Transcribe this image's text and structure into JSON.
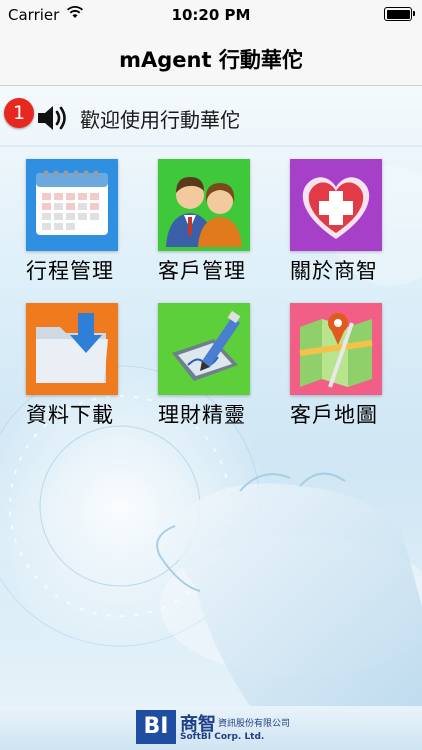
{
  "status_bar": {
    "carrier": "Carrier",
    "time": "10:20 PM"
  },
  "nav": {
    "title": "mAgent 行動華佗"
  },
  "announcement": {
    "badge_count": "1",
    "text": "歡迎使用行動華佗"
  },
  "menu": [
    {
      "label": "行程管理",
      "icon": "calendar-icon"
    },
    {
      "label": "客戶管理",
      "icon": "customers-icon"
    },
    {
      "label": "關於商智",
      "icon": "heart-cross-icon"
    },
    {
      "label": "資料下載",
      "icon": "download-folder-icon"
    },
    {
      "label": "理財精靈",
      "icon": "tablet-pen-icon"
    },
    {
      "label": "客戶地圖",
      "icon": "map-pin-icon"
    }
  ],
  "footer": {
    "logo_mark": "BI",
    "company_cn": "商智",
    "company_cn_full": "資訊股份有限公司",
    "company_en": "SoftBI Corp. Ltd."
  },
  "colors": {
    "badge": "#e8281f",
    "calendar_tile": "#2f8fe0",
    "customers_tile": "#3ec83a",
    "about_tile": "#a640c8",
    "download_tile": "#f07b1e",
    "finance_tile": "#5ccf3a",
    "map_tile": "#f25f86"
  }
}
